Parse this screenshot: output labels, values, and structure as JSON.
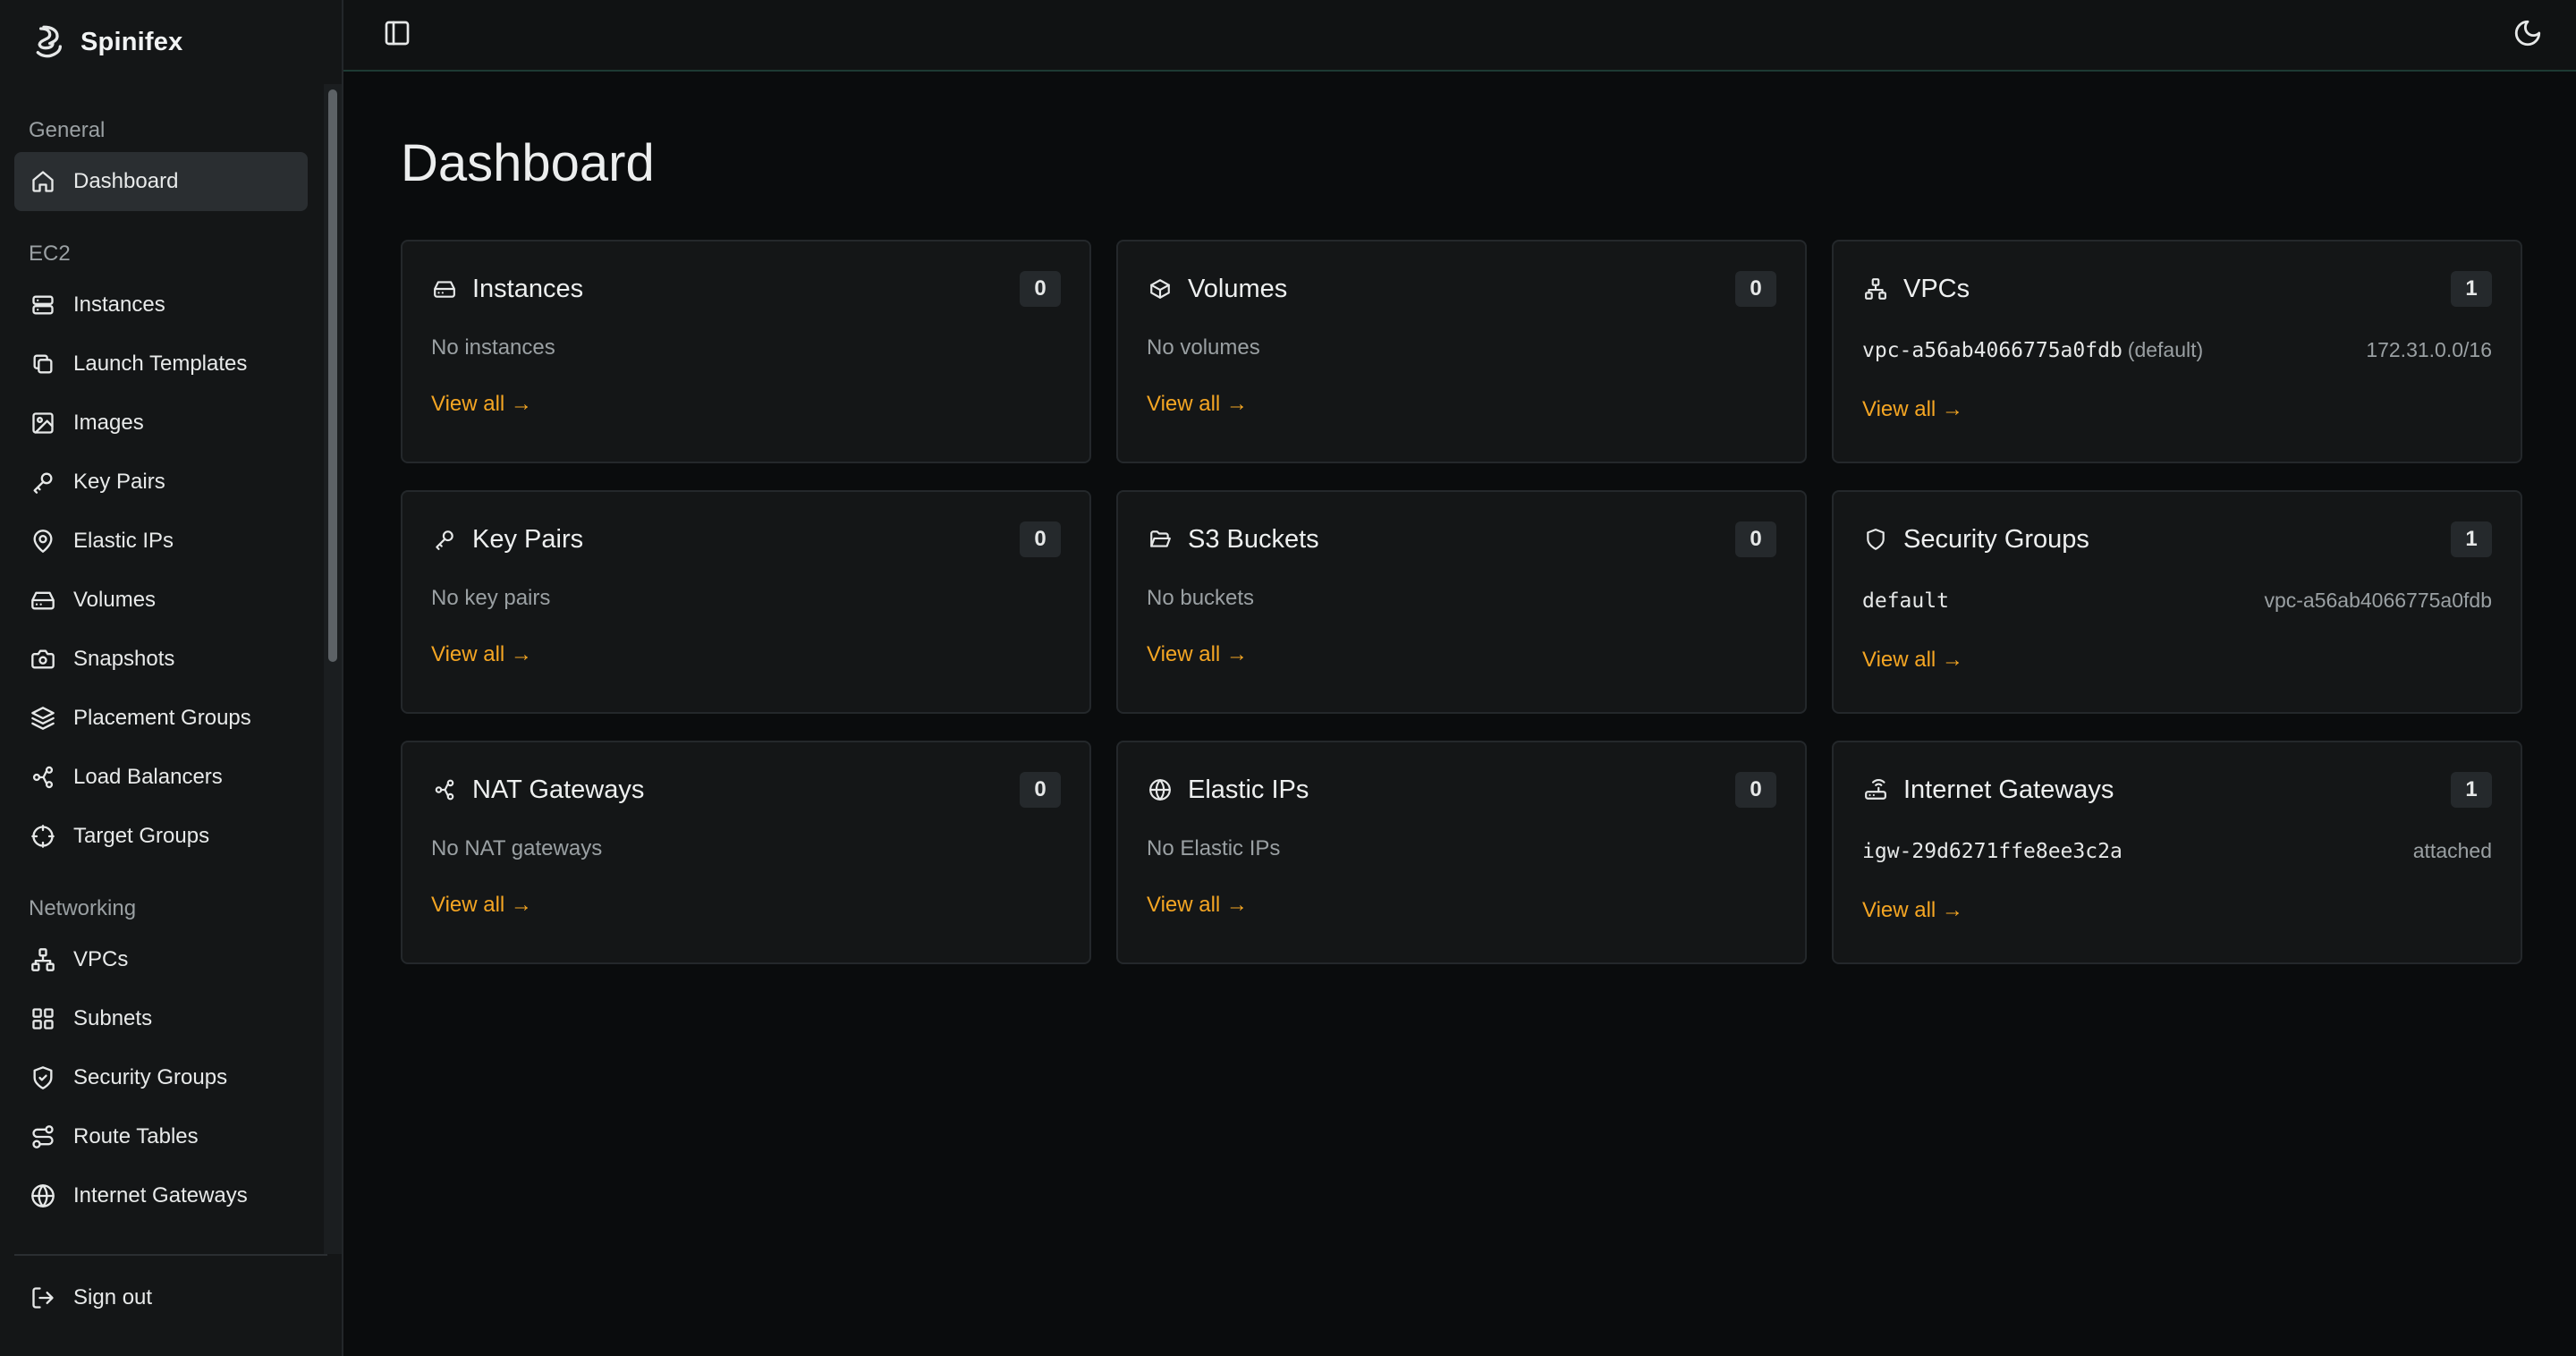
{
  "brand": {
    "name": "Spinifex"
  },
  "sidebar": {
    "sections": [
      {
        "label": "General",
        "items": [
          {
            "label": "Dashboard",
            "icon": "home-icon",
            "active": true
          }
        ]
      },
      {
        "label": "EC2",
        "items": [
          {
            "label": "Instances",
            "icon": "server-icon"
          },
          {
            "label": "Launch Templates",
            "icon": "copy-icon"
          },
          {
            "label": "Images",
            "icon": "image-icon"
          },
          {
            "label": "Key Pairs",
            "icon": "key-icon"
          },
          {
            "label": "Elastic IPs",
            "icon": "map-pin-icon"
          },
          {
            "label": "Volumes",
            "icon": "hard-drive-icon"
          },
          {
            "label": "Snapshots",
            "icon": "camera-icon"
          },
          {
            "label": "Placement Groups",
            "icon": "layers-icon"
          },
          {
            "label": "Load Balancers",
            "icon": "workflow-icon"
          },
          {
            "label": "Target Groups",
            "icon": "crosshair-icon"
          }
        ]
      },
      {
        "label": "Networking",
        "items": [
          {
            "label": "VPCs",
            "icon": "network-icon"
          },
          {
            "label": "Subnets",
            "icon": "grid-icon"
          },
          {
            "label": "Security Groups",
            "icon": "shield-check-icon"
          },
          {
            "label": "Route Tables",
            "icon": "route-icon"
          },
          {
            "label": "Internet Gateways",
            "icon": "globe-icon"
          }
        ]
      }
    ],
    "footer": {
      "sign_out": "Sign out"
    }
  },
  "topbar": {
    "toggle_icon": "sidebar-toggle-icon",
    "theme_icon": "moon-icon"
  },
  "page": {
    "title": "Dashboard"
  },
  "cards": {
    "instances": {
      "title": "Instances",
      "count": "0",
      "empty": "No instances",
      "link": "View all →"
    },
    "volumes": {
      "title": "Volumes",
      "count": "0",
      "empty": "No volumes",
      "link": "View all →"
    },
    "vpcs": {
      "title": "VPCs",
      "count": "1",
      "id": "vpc-a56ab4066775a0fdb",
      "note": "(default)",
      "cidr": "172.31.0.0/16",
      "link": "View all →"
    },
    "key_pairs": {
      "title": "Key Pairs",
      "count": "0",
      "empty": "No key pairs",
      "link": "View all →"
    },
    "s3_buckets": {
      "title": "S3 Buckets",
      "count": "0",
      "empty": "No buckets",
      "link": "View all →"
    },
    "security_groups": {
      "title": "Security Groups",
      "count": "1",
      "name": "default",
      "vpc": "vpc-a56ab4066775a0fdb",
      "link": "View all →"
    },
    "nat_gateways": {
      "title": "NAT Gateways",
      "count": "0",
      "empty": "No NAT gateways",
      "link": "View all →"
    },
    "elastic_ips": {
      "title": "Elastic IPs",
      "count": "0",
      "empty": "No Elastic IPs",
      "link": "View all →"
    },
    "internet_gateways": {
      "title": "Internet Gateways",
      "count": "1",
      "id": "igw-29d6271ffe8ee3c2a",
      "status": "attached",
      "link": "View all →"
    }
  },
  "colors": {
    "accent": "#f5a623",
    "background": "#0a0c0d",
    "card": "#141617",
    "sidebar": "#141617",
    "active_item": "#2a2e31"
  }
}
